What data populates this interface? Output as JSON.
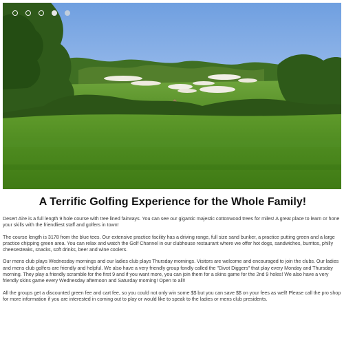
{
  "slider": {
    "dots": [
      {
        "state": "inactive"
      },
      {
        "state": "inactive"
      },
      {
        "state": "inactive"
      },
      {
        "state": "active"
      },
      {
        "state": "faded"
      }
    ],
    "image_icon": "golf-course-photo"
  },
  "main": {
    "heading": "A Terrific Golfing Experience for the Whole Family!",
    "paragraphs": [
      "Desert Aire is a full length 9 hole course with tree lined fairways. You can see our gigantic majestic cottonwood trees for miles! A great place to learn or hone your skills with the friendliest staff and golfers in town!",
      "The course length is 3178 from the blue tees. Our extensive practice facility has a driving range, full size sand bunker, a practice putting green and a large practice chipping green area. You can relax and watch the Golf Channel in our clubhouse restaurant where we offer hot dogs, sandwiches, burritos, philly cheesesteaks, snacks, soft drinks, beer and wine coolers.",
      "Our mens club plays Wednesday mornings and our ladies club plays Thursday mornings. Visitors are welcome and encouraged to join the clubs. Our ladies and mens club golfers are friendly and helpful. We also have a very friendly group fondly called the \"Divot Diggers\" that play every Monday and Thursday morning. They play a friendly scramble for the first 9 and if you want more, you can join them for a skins game for the 2nd 9 holes! We also have a very friendly skins game every Wednesday afternoon and Saturday morning! Open to all!!",
      "All the groups get a discounted green fee and cart fee, so you could not only win some $$ but you can save $$ on your fees as well! Please call the pro shop for more information if you are interested in coming out to play or would like to speak to the ladies or mens club presidents."
    ]
  }
}
